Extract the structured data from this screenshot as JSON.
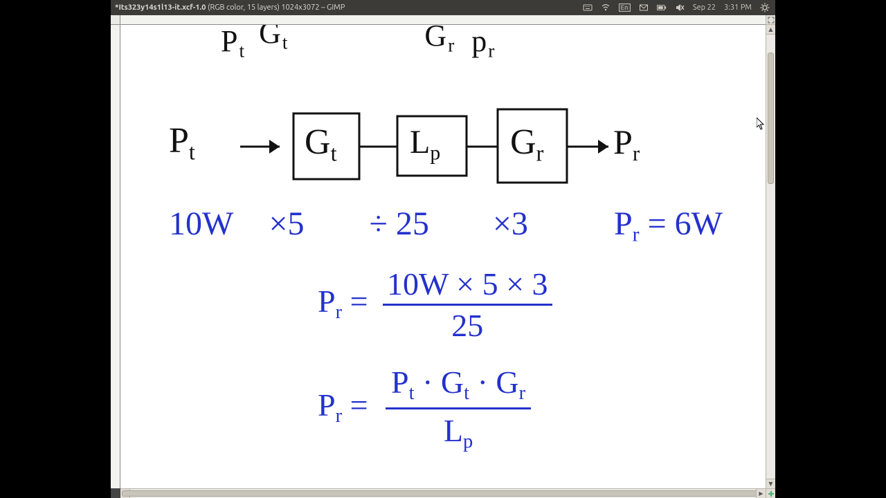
{
  "panel": {
    "title_prefix": "*Its323y14s1l13-it.xcf-1.0",
    "title_mode": "(RGB color, 15 layers)",
    "title_dims": "1024x3072",
    "title_app": "– GIMP",
    "lang": "En",
    "date": "Sep 22",
    "time": "3:31 PM"
  },
  "diagram": {
    "header": {
      "Pt_label": "P",
      "Pt_sub": "t",
      "Gt_label": "G",
      "Gt_sub": "t",
      "Gr_label": "G",
      "Gr_sub": "r",
      "Pr_label": "p",
      "Pr_sub": "r"
    },
    "flow": {
      "Pt": "P",
      "Pt_sub": "t",
      "box1": "G",
      "box1_sub": "t",
      "box2": "L",
      "box2_sub": "p",
      "box3": "G",
      "box3_sub": "r",
      "Pr": "P",
      "Pr_sub": "r"
    },
    "line1": {
      "a": "10W",
      "b": "×5",
      "c": "÷ 25",
      "d": "×3",
      "e_lhs": "P",
      "e_lhs_sub": "r",
      "e_rhs": "= 6W"
    },
    "eq1": {
      "lhs": "P",
      "lhs_sub": "r",
      "num": "10W × 5 × 3",
      "den": "25"
    },
    "eq2": {
      "lhs": "P",
      "lhs_sub": "r",
      "n1": "P",
      "n1s": "t",
      "n2": "G",
      "n2s": "t",
      "n3": "G",
      "n3s": "r",
      "den": "L",
      "den_sub": "p"
    }
  }
}
